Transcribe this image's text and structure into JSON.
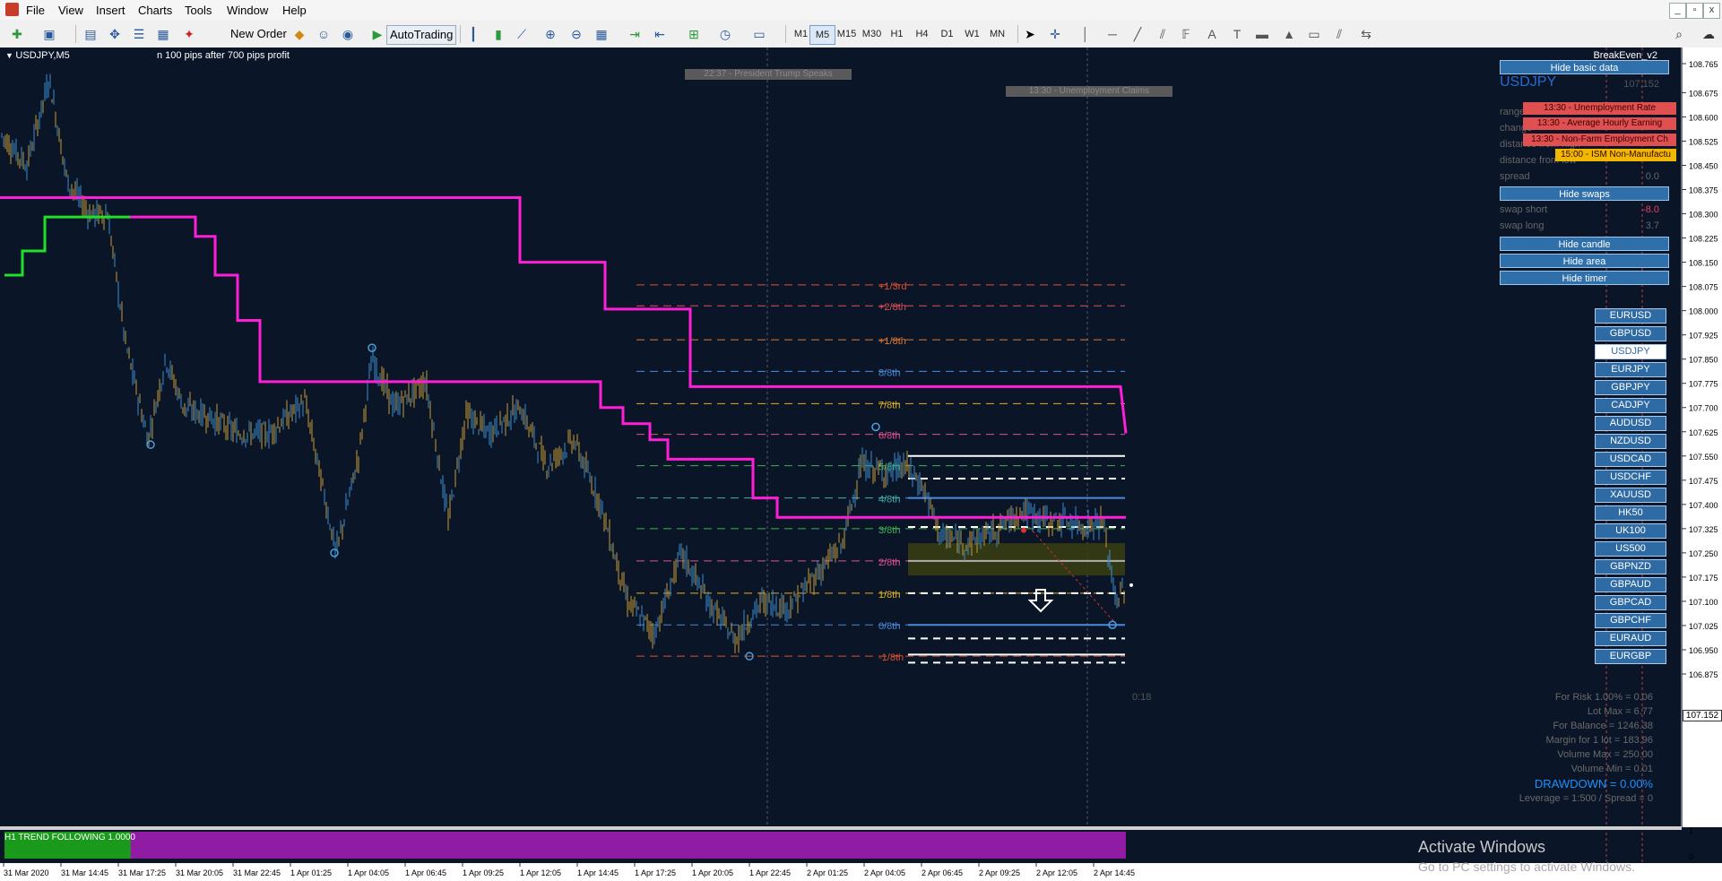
{
  "menu": [
    "File",
    "View",
    "Insert",
    "Charts",
    "Tools",
    "Window",
    "Help"
  ],
  "window_controls": {
    "minimize": "_",
    "restore": "▫",
    "close": "x"
  },
  "toolbar": {
    "new_order": "New Order",
    "autotrading": "AutoTrading",
    "timeframes": [
      "M1",
      "M5",
      "M15",
      "M30",
      "H1",
      "H4",
      "D1",
      "W1",
      "MN"
    ],
    "active_timeframe": "M5"
  },
  "chart": {
    "symbol_label": "USDJPY,M5",
    "comment": "n 100 pips after 700 pips profit",
    "ea_name": "BreakEven_v2",
    "current_price_label": "107.152",
    "timer": "0:18",
    "trend_bar_label": "H1 TREND FOLLOWING 1.0000",
    "activate_windows": {
      "title": "Activate Windows",
      "subtitle": "Go to PC settings to activate Windows."
    }
  },
  "events": [
    {
      "text": "22:37 - President Trump Speaks"
    },
    {
      "text": "13:30 - Unemployment Claims"
    }
  ],
  "news_list": [
    {
      "text": "13:30 - Unemployment Rate",
      "color": "#e05050"
    },
    {
      "text": "13:30 - Average Hourly Earning",
      "color": "#e05050"
    },
    {
      "text": "13:30 - Non-Farm Employment Ch",
      "color": "#e05050"
    },
    {
      "text": "15:00 - ISM Non-Manufactu",
      "color": "#f0b800"
    }
  ],
  "panel": {
    "hide_basic": "Hide basic data",
    "symbol": "USDJPY",
    "symbol_price": "107.152",
    "rows": [
      {
        "label": "range",
        "value": ""
      },
      {
        "label": "change",
        "value": ""
      },
      {
        "label": "distance from high",
        "value": ""
      },
      {
        "label": "distance from low",
        "value": ""
      },
      {
        "label": "spread",
        "value": "0.0"
      }
    ],
    "hide_swaps": "Hide swaps",
    "swap_short_label": "swap short",
    "swap_short": "-8.0",
    "swap_long_label": "swap long",
    "swap_long": "3.7",
    "hide_candle": "Hide candle",
    "hide_area": "Hide area",
    "hide_timer": "Hide timer"
  },
  "symbols": [
    "EURUSD",
    "GBPUSD",
    "USDJPY",
    "EURJPY",
    "GBPJPY",
    "CADJPY",
    "AUDUSD",
    "NZDUSD",
    "USDCAD",
    "USDCHF",
    "XAUUSD",
    "HK50",
    "UK100",
    "US500",
    "GBPNZD",
    "GBPAUD",
    "GBPCAD",
    "GBPCHF",
    "EURAUD",
    "EURGBP"
  ],
  "selected_symbol": "USDJPY",
  "stats": {
    "for_risk": "For Risk 1.00% = 0.06",
    "lot_max": "Lot Max = 6.77",
    "for_balance": "For Balance = 1246.38",
    "margin": "Margin for 1 lot = 183.96",
    "volume_max": "Volume Max = 250.00",
    "volume_min": "Volume Min = 0.01",
    "drawdown": "DRAWDOWN = 0.00%",
    "leverage": "Leverage = 1:500 / Spread = 0"
  },
  "murrey_levels": [
    {
      "label": "+1/3rd",
      "color": "#e0502a"
    },
    {
      "label": "+2/8th",
      "color": "#e0505a"
    },
    {
      "label": "+1/8th",
      "color": "#e07a30"
    },
    {
      "label": "8/8th",
      "color": "#4a8ad8"
    },
    {
      "label": "7/8th",
      "color": "#e0b020"
    },
    {
      "label": "6/8th",
      "color": "#e05090"
    },
    {
      "label": "5/8th",
      "color": "#40b050"
    },
    {
      "label": "4/8th",
      "color": "#40b0b0"
    },
    {
      "label": "3/8th",
      "color": "#40b050"
    },
    {
      "label": "2/8th",
      "color": "#e05090"
    },
    {
      "label": "1/8th",
      "color": "#e0b020"
    },
    {
      "label": "0/8th",
      "color": "#4a8ad8"
    },
    {
      "label": "-1/8th",
      "color": "#e0502a"
    }
  ],
  "price_axis": [
    "108.765",
    "108.675",
    "108.600",
    "108.525",
    "108.450",
    "108.375",
    "108.300",
    "108.225",
    "108.150",
    "108.075",
    "108.000",
    "107.925",
    "107.850",
    "107.775",
    "107.700",
    "107.625",
    "107.550",
    "107.475",
    "107.400",
    "107.325",
    "107.250",
    "107.175",
    "107.100",
    "107.025",
    "106.950",
    "106.875"
  ],
  "indicator_axis": [
    "1",
    "0"
  ],
  "time_axis": [
    "31 Mar 2020",
    "31 Mar 14:45",
    "31 Mar 17:25",
    "31 Mar 20:05",
    "31 Mar 22:45",
    "1 Apr 01:25",
    "1 Apr 04:05",
    "1 Apr 06:45",
    "1 Apr 09:25",
    "1 Apr 12:05",
    "1 Apr 14:45",
    "1 Apr 17:25",
    "1 Apr 20:05",
    "1 Apr 22:45",
    "2 Apr 01:25",
    "2 Apr 04:05",
    "2 Apr 06:45",
    "2 Apr 09:25",
    "2 Apr 12:05",
    "2 Apr 14:45"
  ],
  "colors": {
    "background": "#0b1528",
    "magenta": "#ff1ed8",
    "green": "#22e02a",
    "bull": "#3a8fd0",
    "bear": "#c89a30"
  }
}
